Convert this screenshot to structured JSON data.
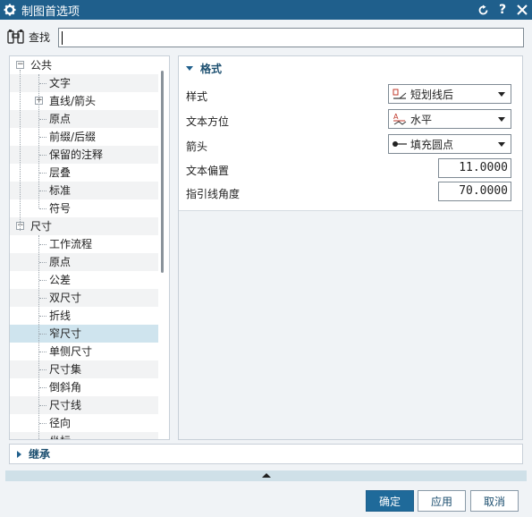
{
  "window": {
    "title": "制图首选项",
    "icons": {
      "app": "gear-icon",
      "reset": "reset-icon",
      "help": "help-icon",
      "close": "close-icon"
    }
  },
  "search": {
    "label": "查找",
    "value": "",
    "placeholder": ""
  },
  "tree": {
    "groups": [
      {
        "label": "公共",
        "expander": "−",
        "items": [
          {
            "label": "文字"
          },
          {
            "label": "直线/箭头",
            "expander": "+"
          },
          {
            "label": "原点"
          },
          {
            "label": "前缀/后缀"
          },
          {
            "label": "保留的注释"
          },
          {
            "label": "层叠"
          },
          {
            "label": "标准"
          },
          {
            "label": "符号"
          }
        ]
      },
      {
        "label": "尺寸",
        "expander": "−",
        "items": [
          {
            "label": "工作流程"
          },
          {
            "label": "原点"
          },
          {
            "label": "公差"
          },
          {
            "label": "双尺寸"
          },
          {
            "label": "折线"
          },
          {
            "label": "窄尺寸",
            "selected": true
          },
          {
            "label": "单侧尺寸"
          },
          {
            "label": "尺寸集"
          },
          {
            "label": "倒斜角"
          },
          {
            "label": "尺寸线"
          },
          {
            "label": "径向"
          },
          {
            "label": "坐标"
          }
        ]
      }
    ]
  },
  "format": {
    "header": "格式",
    "style_label": "样式",
    "style_value": "短划线后",
    "text_orientation_label": "文本方位",
    "text_orientation_value": "水平",
    "arrow_label": "箭头",
    "arrow_value": "填充圆点",
    "text_offset_label": "文本偏置",
    "text_offset_value": "11.0000",
    "leader_angle_label": "指引线角度",
    "leader_angle_value": "70.0000"
  },
  "inherit": {
    "label": "继承"
  },
  "buttons": {
    "ok": "确定",
    "apply": "应用",
    "cancel": "取消"
  },
  "colors": {
    "titlebar": "#1f5f8c",
    "accent": "#1b4e6f",
    "selected_row": "#cfe4ee"
  }
}
